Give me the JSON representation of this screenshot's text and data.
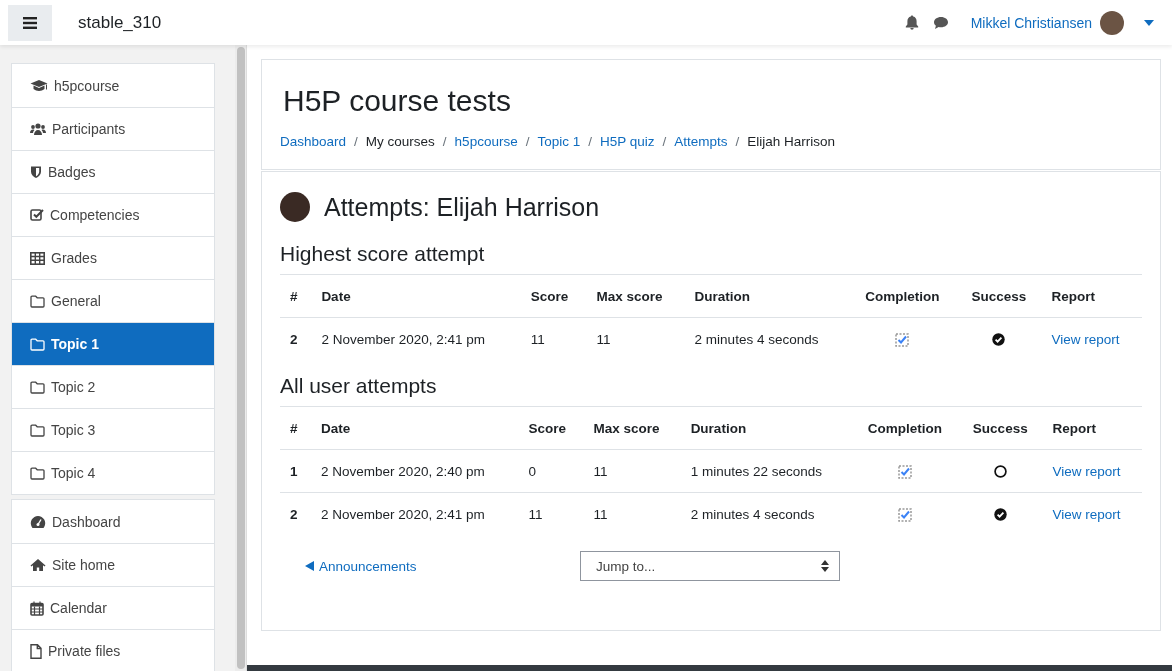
{
  "navbar": {
    "site_name": "stable_310",
    "user_name": "Mikkel Christiansen"
  },
  "sidebar": {
    "groups": [
      {
        "items": [
          {
            "label": "h5pcourse",
            "selected": false
          },
          {
            "label": "Participants",
            "selected": false
          },
          {
            "label": "Badges",
            "selected": false
          },
          {
            "label": "Competencies",
            "selected": false
          },
          {
            "label": "Grades",
            "selected": false
          },
          {
            "label": "General",
            "selected": false
          },
          {
            "label": "Topic 1",
            "selected": true
          },
          {
            "label": "Topic 2",
            "selected": false
          },
          {
            "label": "Topic 3",
            "selected": false
          },
          {
            "label": "Topic 4",
            "selected": false
          }
        ]
      },
      {
        "items": [
          {
            "label": "Dashboard",
            "selected": false
          },
          {
            "label": "Site home",
            "selected": false
          },
          {
            "label": "Calendar",
            "selected": false
          },
          {
            "label": "Private files",
            "selected": false
          }
        ]
      }
    ]
  },
  "page_header": {
    "title": "H5P course tests",
    "breadcrumb": [
      {
        "label": "Dashboard",
        "link": true
      },
      {
        "separator": "/",
        "label": "My courses",
        "link": false
      },
      {
        "separator": "/",
        "label": "h5pcourse",
        "link": true
      },
      {
        "separator": "/",
        "label": "Topic 1",
        "link": true
      },
      {
        "separator": "/",
        "label": "H5P quiz",
        "link": true
      },
      {
        "separator": "/",
        "label": "Attempts",
        "link": true
      },
      {
        "separator": "/",
        "label": "Elijah Harrison",
        "link": false
      }
    ]
  },
  "content": {
    "title": "Attempts: Elijah Harrison",
    "sections": [
      {
        "heading": "Highest score attempt",
        "columns": [
          "#",
          "Date",
          "Score",
          "Max score",
          "Duration",
          "Completion",
          "Success",
          "Report"
        ],
        "rows": [
          {
            "number": "2",
            "date": "2 November 2020, 2:41 pm",
            "score": "11",
            "max_score": "11",
            "duration": "2 minutes 4 seconds",
            "completed": true,
            "success": true,
            "report": "View report"
          }
        ]
      },
      {
        "heading": "All user attempts",
        "columns": [
          "#",
          "Date",
          "Score",
          "Max score",
          "Duration",
          "Completion",
          "Success",
          "Report"
        ],
        "rows": [
          {
            "number": "1",
            "date": "2 November 2020, 2:40 pm",
            "score": "0",
            "max_score": "11",
            "duration": "1 minutes 22 seconds",
            "completed": true,
            "success": false,
            "report": "View report"
          },
          {
            "number": "2",
            "date": "2 November 2020, 2:41 pm",
            "score": "11",
            "max_score": "11",
            "duration": "2 minutes 4 seconds",
            "completed": true,
            "success": true,
            "report": "View report"
          }
        ]
      }
    ],
    "prev_link": "Announcements",
    "jump_select": {
      "value": "Jump to..."
    }
  }
}
